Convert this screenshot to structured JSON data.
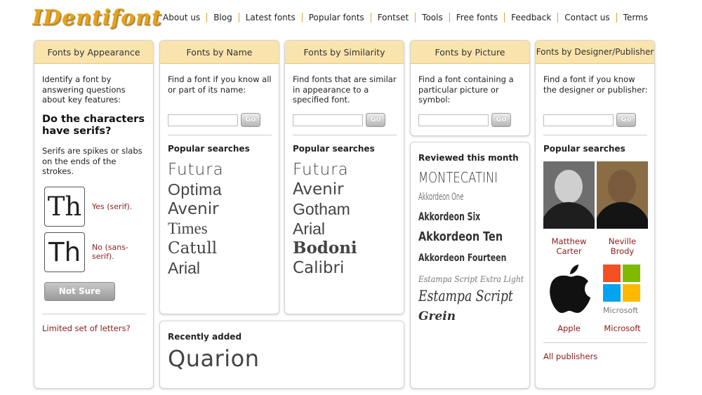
{
  "site": {
    "logo": "IDentifont"
  },
  "nav": [
    "About us",
    "Blog",
    "Latest fonts",
    "Popular fonts",
    "Fontset",
    "Tools",
    "Free fonts",
    "Feedback",
    "Contact us",
    "Terms"
  ],
  "appearance": {
    "title": "Fonts by Appearance",
    "desc": "Identify a font by answering questions about key features:",
    "question": "Do the characters have serifs?",
    "explain": "Serifs are spikes or slabs on the ends of the strokes.",
    "serif_sample": "Th",
    "sans_sample": "Th",
    "yes_label": "Yes (serif).",
    "no_label": "No (sans-serif).",
    "notsure_label": "Not Sure",
    "limited_link": "Limited set of letters?"
  },
  "byname": {
    "title": "Fonts by Name",
    "desc": "Find a font if you know all or part of its name:",
    "go_label": "Go",
    "popular_heading": "Popular searches",
    "popular": [
      "Futura",
      "Optima",
      "Avenir",
      "Times",
      "Catull",
      "Arial"
    ]
  },
  "recent": {
    "heading": "Recently added",
    "font": "Quarion"
  },
  "similarity": {
    "title": "Fonts by Similarity",
    "desc": "Find fonts that are similar in appearance to a specified font.",
    "go_label": "Go",
    "popular_heading": "Popular searches",
    "popular": [
      "Futura",
      "Avenir",
      "Gotham",
      "Arial",
      "Bodoni",
      "Calibri"
    ]
  },
  "picture": {
    "title": "Fonts by Picture",
    "desc": "Find a font containing a particular picture or symbol:",
    "go_label": "Go",
    "reviewed_heading": "Reviewed this month",
    "reviewed": [
      "MONTECATINI",
      "Akkordeon One",
      "Akkordeon Six",
      "Akkordeon Ten",
      "Akkordeon Fourteen",
      "Estampa Script Extra Light",
      "Estampa Script",
      "Grein"
    ]
  },
  "designer": {
    "title": "Fonts by Designer/Publisher",
    "desc": "Find a font if you know the designer or publisher:",
    "go_label": "Go",
    "popular_heading": "Popular searches",
    "people": [
      {
        "name": "Matthew Carter"
      },
      {
        "name": "Neville Brody"
      }
    ],
    "publishers": [
      {
        "name": "Apple"
      },
      {
        "name": "Microsoft",
        "logo_text": "Microsoft"
      }
    ],
    "all_link": "All publishers"
  }
}
